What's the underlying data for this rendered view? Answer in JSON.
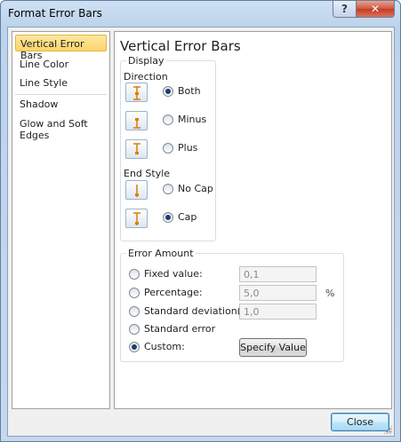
{
  "window": {
    "title": "Format Error Bars",
    "help_label": "?",
    "close_label": "✕"
  },
  "nav": {
    "items": [
      {
        "label": "Vertical Error Bars",
        "selected": true
      },
      {
        "label": "Line Color"
      },
      {
        "label": "Line Style"
      },
      {
        "label": "Shadow"
      },
      {
        "label": "Glow and Soft Edges"
      }
    ]
  },
  "panel": {
    "title": "Vertical Error Bars",
    "display": {
      "label": "Display",
      "direction_label": "Direction",
      "direction_options": [
        {
          "label": "Both",
          "icon": "both-direction-icon",
          "checked": true
        },
        {
          "label": "Minus",
          "icon": "minus-direction-icon",
          "checked": false
        },
        {
          "label": "Plus",
          "icon": "plus-direction-icon",
          "checked": false
        }
      ],
      "end_style_label": "End Style",
      "end_style_options": [
        {
          "label": "No Cap",
          "icon": "no-cap-icon",
          "checked": false
        },
        {
          "label": "Cap",
          "icon": "cap-icon",
          "checked": true
        }
      ]
    },
    "error_amount": {
      "label": "Error Amount",
      "fixed_value": {
        "label": "Fixed value:",
        "value": "0,1"
      },
      "percentage": {
        "label": "Percentage:",
        "value": "5,0",
        "unit": "%"
      },
      "std_dev": {
        "label": "Standard deviation(s):",
        "value": "1,0"
      },
      "std_error": {
        "label": "Standard error"
      },
      "custom": {
        "label": "Custom:",
        "checked": true
      },
      "specify_value_label": "Specify Value"
    }
  },
  "footer": {
    "close_label": "Close"
  },
  "colors": {
    "accent_orange": "#e07b00",
    "selected_nav": "#fbd46b"
  }
}
